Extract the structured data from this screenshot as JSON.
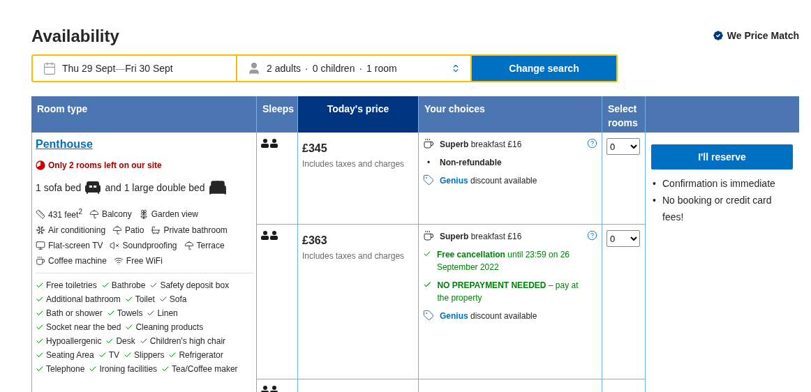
{
  "title": "Availability",
  "price_match": "We Price Match",
  "search": {
    "checkin": "Thu 29 Sept",
    "separator": "—",
    "checkout": "Fri 30 Sept",
    "guests": [
      "2 adults",
      "0 children",
      "1 room"
    ],
    "guest_separator": "·",
    "button": "Change search"
  },
  "table": {
    "columns": [
      {
        "label": "Room type",
        "highlighted": false
      },
      {
        "label": "Sleeps",
        "highlighted": false
      },
      {
        "label": "Today's price",
        "highlighted": true
      },
      {
        "label": "Your choices",
        "highlighted": false
      },
      {
        "label": "Select rooms",
        "highlighted": false
      }
    ]
  },
  "room": {
    "name": "Penthouse",
    "scarcity": "Only 2 rooms left on our site",
    "beds": [
      {
        "text": "1 sofa bed",
        "kind": "sofa"
      },
      {
        "text": "and 1 large double bed",
        "kind": "double"
      }
    ],
    "facilities": [
      {
        "label": "431 feet$^{2}$",
        "kind": "size"
      },
      {
        "label": "Balcony",
        "kind": "balcony"
      },
      {
        "label": "Garden view",
        "kind": "garden"
      },
      {
        "label": "Air conditioning",
        "kind": "ac"
      },
      {
        "label": "Patio",
        "kind": "patio"
      },
      {
        "label": "Private bathroom",
        "kind": "bathroom"
      },
      {
        "label": "Flat-screen TV",
        "kind": "tv"
      },
      {
        "label": "Soundproofing",
        "kind": "soundproofing"
      },
      {
        "label": "Terrace",
        "kind": "terrace"
      },
      {
        "label": "Coffee machine",
        "kind": "coffee"
      },
      {
        "label": "Free WiFi",
        "kind": "wifi"
      }
    ],
    "amenities": [
      "Free toiletries",
      "Bathrobe",
      "Safety deposit box",
      "Additional bathroom",
      "Toilet",
      "Sofa",
      "Bath or shower",
      "Towels",
      "Linen",
      "Socket near the bed",
      "Cleaning products",
      "Hypoallergenic",
      "Desk",
      "Children's high chair",
      "Seating Area",
      "TV",
      "Slippers",
      "Refrigerator",
      "Telephone",
      "Ironing facilities",
      "Tea/Coffee maker"
    ]
  },
  "options": [
    {
      "price": "£345",
      "price_note": "Includes taxes and charges",
      "select": "0",
      "choices": [
        {
          "kind": "meal",
          "text": "**Superb** breakfast £16"
        },
        {
          "kind": "bullet",
          "marker": "•",
          "text": "Non-refundable"
        },
        {
          "kind": "genius",
          "text": "**Genius** discount available"
        }
      ]
    },
    {
      "price": "£363",
      "price_note": "Includes taxes and charges",
      "select": "0",
      "choices": [
        {
          "kind": "meal",
          "text": "**Superb** breakfast £16"
        },
        {
          "kind": "check",
          "text": "**Free cancellation** until 23:59 on 26 September 2022"
        },
        {
          "kind": "check",
          "text": "**NO PREPAYMENT NEEDED** – pay at the property"
        },
        {
          "kind": "genius",
          "text": "**Genius** discount available"
        }
      ]
    }
  ],
  "reserve": {
    "button": "I'll reserve",
    "notes": [
      {
        "marker": "•",
        "text": "Confirmation is immediate"
      },
      {
        "marker": "•",
        "text": "No booking or credit card fees!"
      }
    ]
  }
}
